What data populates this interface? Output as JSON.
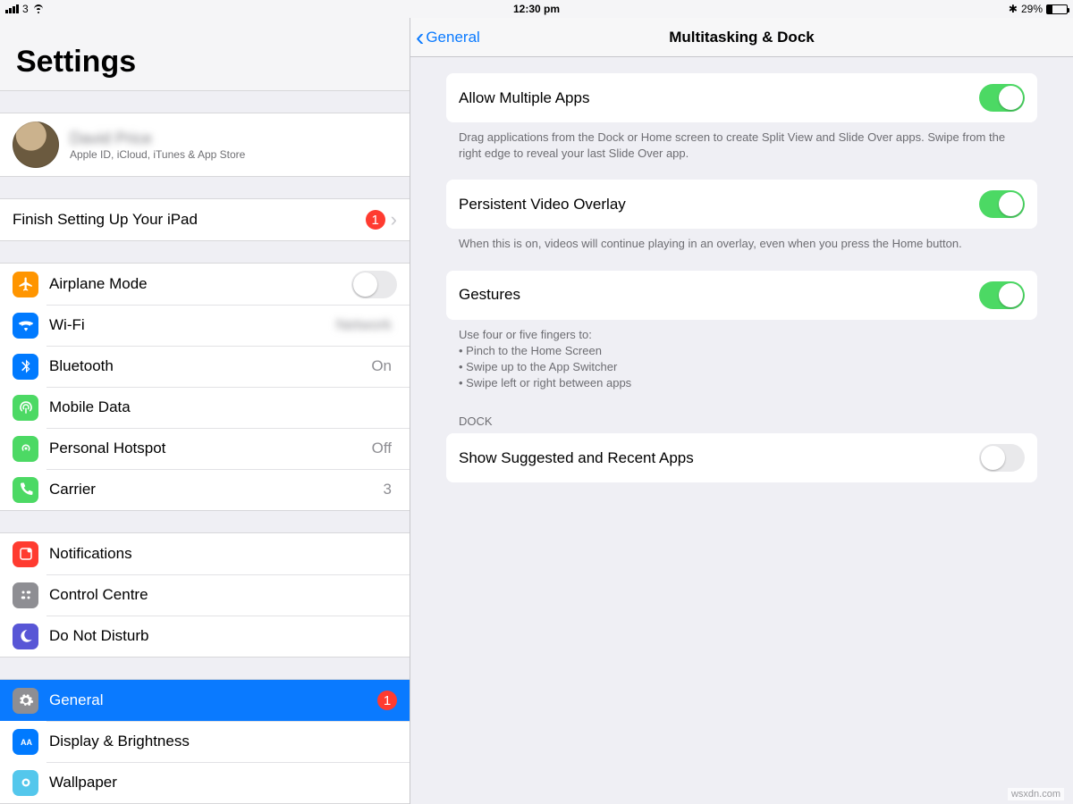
{
  "status": {
    "carrier": "3",
    "time": "12:30 pm",
    "battery_pct": "29%"
  },
  "sidebar": {
    "title": "Settings",
    "user": {
      "name": "David Price",
      "sub": "Apple ID, iCloud, iTunes & App Store"
    },
    "finish": {
      "label": "Finish Setting Up Your iPad",
      "badge": "1"
    },
    "group1": {
      "airplane": "Airplane Mode",
      "wifi": "Wi-Fi",
      "wifi_val": "Network",
      "bluetooth": "Bluetooth",
      "bt_val": "On",
      "mobile": "Mobile Data",
      "hotspot": "Personal Hotspot",
      "hotspot_val": "Off",
      "carrier": "Carrier",
      "carrier_val": "3"
    },
    "group2": {
      "notifications": "Notifications",
      "control": "Control Centre",
      "dnd": "Do Not Disturb"
    },
    "group3": {
      "general": "General",
      "general_badge": "1",
      "display": "Display & Brightness",
      "wallpaper": "Wallpaper"
    }
  },
  "nav": {
    "back": "General",
    "title": "Multitasking & Dock"
  },
  "detail": {
    "allow": "Allow Multiple Apps",
    "allow_foot": "Drag applications from the Dock or Home screen to create Split View and Slide Over apps. Swipe from the right edge to reveal your last Slide Over app.",
    "pip": "Persistent Video Overlay",
    "pip_foot": "When this is on, videos will continue playing in an overlay, even when you press the Home button.",
    "gestures": "Gestures",
    "gfoot_lead": "Use four or five fingers to:",
    "gfoot": [
      "Pinch to the Home Screen",
      "Swipe up to the App Switcher",
      "Swipe left or right between apps"
    ],
    "dock_head": "Dock",
    "dock_item": "Show Suggested and Recent Apps"
  },
  "watermark": "wsxdn.com"
}
